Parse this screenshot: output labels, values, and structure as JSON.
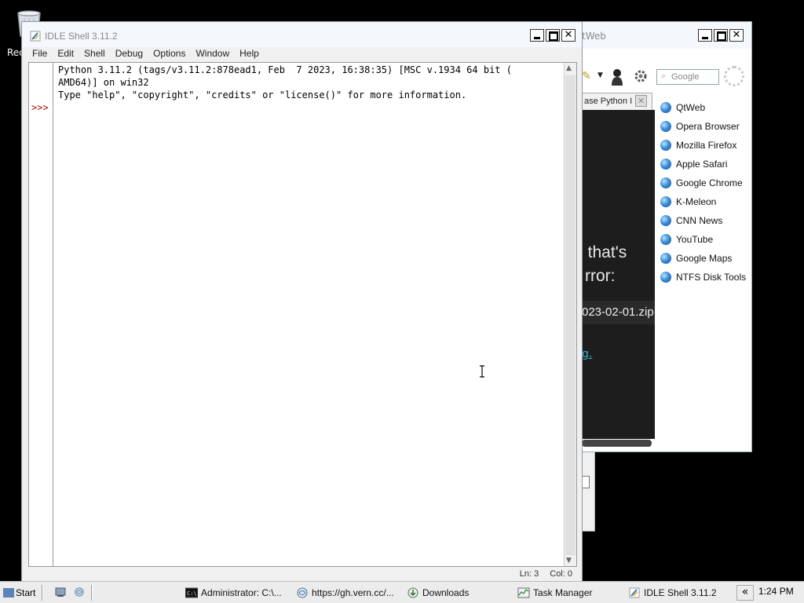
{
  "desktop": {
    "recycle_label": "Rec"
  },
  "qtweb": {
    "title": "tWeb",
    "search_placeholder": "Google",
    "tab_label": "ase Python I",
    "content_line1": ", that's",
    "content_line2": "rror:",
    "content_zip": "023-02-01.zip",
    "content_link": "g.",
    "bookmarks": [
      {
        "label": "QtWeb"
      },
      {
        "label": "Opera Browser"
      },
      {
        "label": "Mozilla Firefox"
      },
      {
        "label": "Apple Safari"
      },
      {
        "label": "Google Chrome"
      },
      {
        "label": "K-Meleon"
      },
      {
        "label": "CNN News"
      },
      {
        "label": "YouTube"
      },
      {
        "label": "Google Maps"
      },
      {
        "label": "NTFS Disk Tools"
      }
    ]
  },
  "idle": {
    "title": "IDLE Shell 3.11.2",
    "menu": [
      {
        "label": "File"
      },
      {
        "label": "Edit"
      },
      {
        "label": "Shell"
      },
      {
        "label": "Debug"
      },
      {
        "label": "Options"
      },
      {
        "label": "Window"
      },
      {
        "label": "Help"
      }
    ],
    "shell_lines": [
      "Python 3.11.2 (tags/v3.11.2:878ead1, Feb  7 2023, 16:38:35) [MSC v.1934 64 bit (",
      "AMD64)] on win32",
      "Type \"help\", \"copyright\", \"credits\" or \"license()\" for more information."
    ],
    "prompt": ">>>",
    "status": {
      "line": "Ln: 3",
      "col": "Col: 0"
    }
  },
  "taskbar": {
    "start_label": "Start",
    "tasks": [
      {
        "label": "Administrator: C:\\..."
      },
      {
        "label": "https://gh.vern.cc/..."
      },
      {
        "label": "Downloads"
      },
      {
        "label": "Task Manager"
      },
      {
        "label": "IDLE Shell 3.11.2"
      }
    ],
    "tray_toggle": "«",
    "clock": "1:24 PM"
  }
}
